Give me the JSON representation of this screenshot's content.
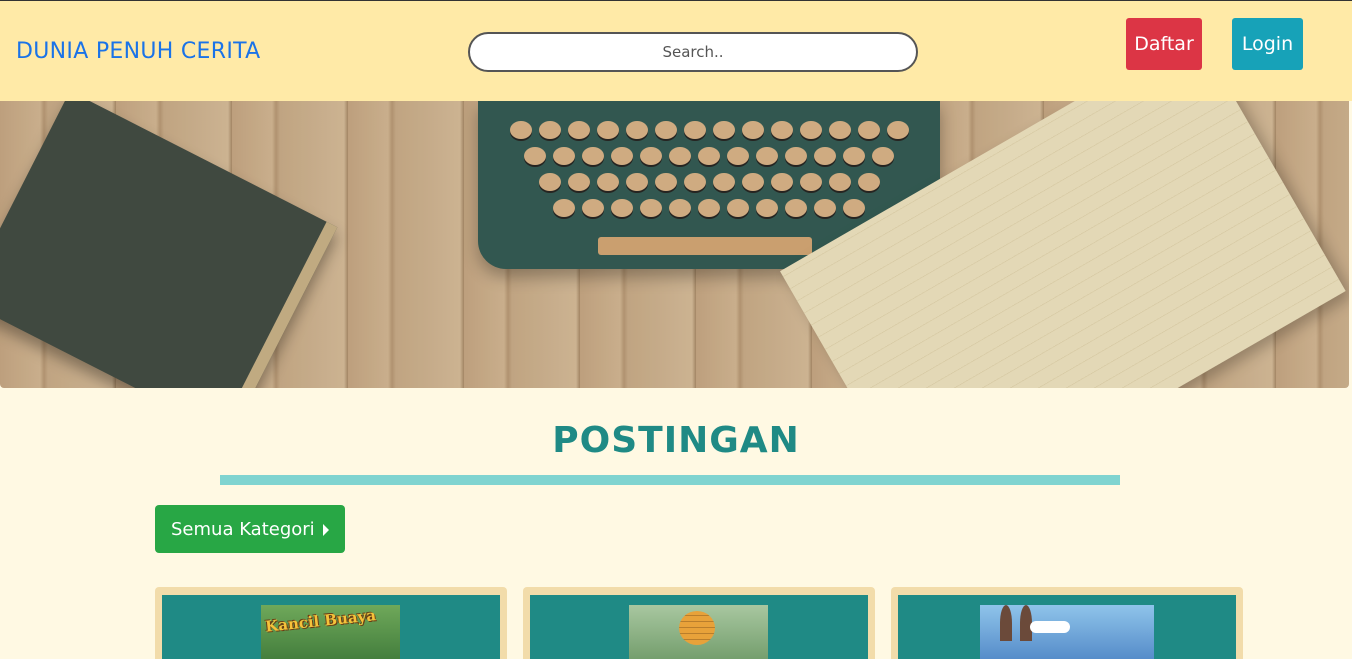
{
  "header": {
    "brand": "DUNIA PENUH CERITA",
    "search_placeholder": "Search..",
    "daftar_label": "Daftar",
    "login_label": "Login"
  },
  "section": {
    "title": "POSTINGAN",
    "category_button_label": "Semua Kategori"
  },
  "colors": {
    "navbar": "#ffeaa7",
    "brand": "#1a73e8",
    "daftar": "#dc3545",
    "login": "#17a2b8",
    "title": "#1f8a85",
    "underline": "#80d4d0",
    "category_button": "#28a745",
    "card_border": "#f2dcaa",
    "card_inner": "#1f8a85",
    "page_bg": "#fff9e3"
  },
  "cards": [
    {
      "thumbnail_text": "Kancil Buaya"
    },
    {
      "thumbnail_text": ""
    },
    {
      "thumbnail_text": ""
    }
  ]
}
